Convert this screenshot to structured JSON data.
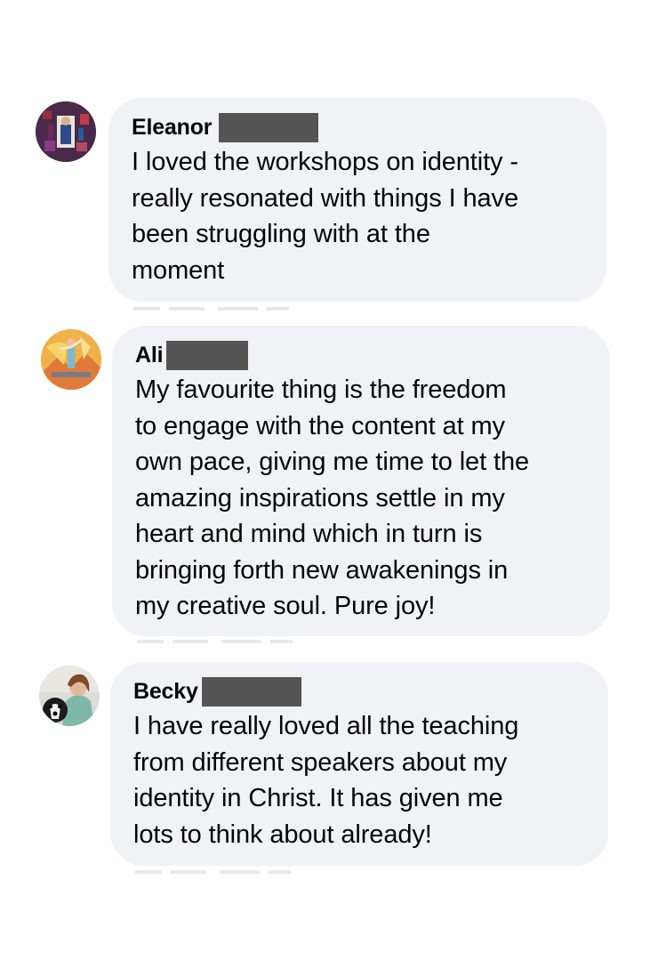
{
  "comments": [
    {
      "name": "Eleanor",
      "lines": [
        "I loved the workshops on identity -",
        "really resonated with things I have",
        "been struggling with at the",
        "moment"
      ]
    },
    {
      "name": "Ali",
      "lines": [
        "My favourite thing is the freedom",
        "to engage with the content at my",
        "own pace, giving me time to let the",
        "amazing inspirations settle in my",
        "heart and mind which in turn is",
        "bringing forth new awakenings in",
        "my creative soul. Pure joy!"
      ]
    },
    {
      "name": "Becky",
      "lines": [
        "I have really loved all the teaching",
        "from different speakers about my",
        "identity in Christ. It has given me",
        "lots to think about already!"
      ]
    }
  ],
  "colors": {
    "bubble": "#f0f2f5",
    "text": "#050505",
    "redaction": "#555555"
  },
  "icons": [
    "avatar-eleanor",
    "avatar-ali",
    "avatar-becky"
  ]
}
